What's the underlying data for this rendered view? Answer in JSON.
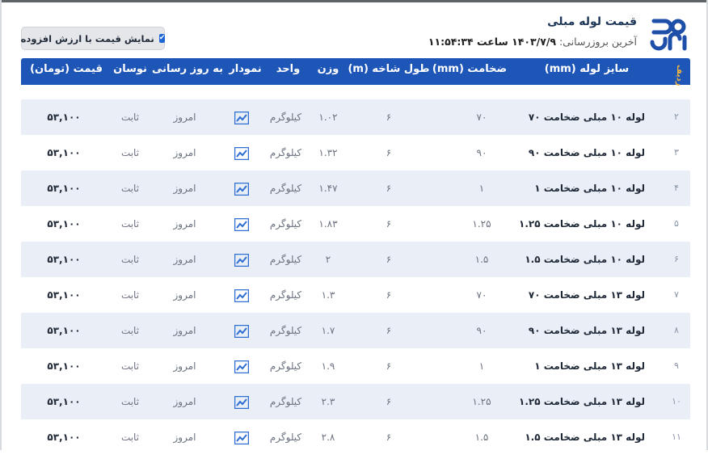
{
  "header": {
    "title": "قیمت لوله مبلی",
    "updated_label": "آخرین بروزرسانی:",
    "updated_value": "۱۴۰۳/۷/۹ ساعت ۱۱:۵۴:۳۴",
    "vat_toggle_label": "نمایش قیمت با ارزش افزوده",
    "vat_checked": true
  },
  "colors": {
    "header_bar": "#1e56b8",
    "alt_row": "#e9eef7",
    "accent": "#1e66d6"
  },
  "table": {
    "columns": {
      "row": "ردیف",
      "size": "سایز لوله (mm)",
      "thickness": "ضخامت (mm)",
      "length": "طول شاخه (m)",
      "weight": "وزن",
      "unit": "واحد",
      "chart": "نمودار",
      "updated": "به روز رسانی",
      "fluctuation": "نوسان",
      "price": "قیمت (تومان)"
    },
    "rows": [
      {
        "num": "۲",
        "size": "لوله ۱۰ مبلی ضخامت ۷۰",
        "thickness": "۷۰",
        "length": "۶",
        "weight": "۱.۰۲",
        "unit": "کیلوگرم",
        "chart_icon": "chart-trend-icon",
        "updated": "امروز",
        "fluctuation": "ثابت",
        "price": "۵۳,۱۰۰"
      },
      {
        "num": "۳",
        "size": "لوله ۱۰ مبلی ضخامت ۹۰",
        "thickness": "۹۰",
        "length": "۶",
        "weight": "۱.۳۲",
        "unit": "کیلوگرم",
        "chart_icon": "chart-trend-icon",
        "updated": "امروز",
        "fluctuation": "ثابت",
        "price": "۵۳,۱۰۰"
      },
      {
        "num": "۴",
        "size": "لوله ۱۰ مبلی ضخامت ۱",
        "thickness": "۱",
        "length": "۶",
        "weight": "۱.۴۷",
        "unit": "کیلوگرم",
        "chart_icon": "chart-trend-icon",
        "updated": "امروز",
        "fluctuation": "ثابت",
        "price": "۵۳,۱۰۰"
      },
      {
        "num": "۵",
        "size": "لوله ۱۰ مبلی ضخامت ۱.۲۵",
        "thickness": "۱.۲۵",
        "length": "۶",
        "weight": "۱.۸۳",
        "unit": "کیلوگرم",
        "chart_icon": "chart-trend-icon",
        "updated": "امروز",
        "fluctuation": "ثابت",
        "price": "۵۳,۱۰۰"
      },
      {
        "num": "۶",
        "size": "لوله ۱۰ مبلی ضخامت ۱.۵",
        "thickness": "۱.۵",
        "length": "۶",
        "weight": "۲",
        "unit": "کیلوگرم",
        "chart_icon": "chart-trend-icon",
        "updated": "امروز",
        "fluctuation": "ثابت",
        "price": "۵۳,۱۰۰"
      },
      {
        "num": "۷",
        "size": "لوله ۱۳ مبلی ضخامت ۷۰",
        "thickness": "۷۰",
        "length": "۶",
        "weight": "۱.۳",
        "unit": "کیلوگرم",
        "chart_icon": "chart-trend-icon",
        "updated": "امروز",
        "fluctuation": "ثابت",
        "price": "۵۳,۱۰۰"
      },
      {
        "num": "۸",
        "size": "لوله ۱۳ مبلی ضخامت ۹۰",
        "thickness": "۹۰",
        "length": "۶",
        "weight": "۱.۷",
        "unit": "کیلوگرم",
        "chart_icon": "chart-trend-icon",
        "updated": "امروز",
        "fluctuation": "ثابت",
        "price": "۵۳,۱۰۰"
      },
      {
        "num": "۹",
        "size": "لوله ۱۳ مبلی ضخامت ۱",
        "thickness": "۱",
        "length": "۶",
        "weight": "۱.۹",
        "unit": "کیلوگرم",
        "chart_icon": "chart-trend-icon",
        "updated": "امروز",
        "fluctuation": "ثابت",
        "price": "۵۳,۱۰۰"
      },
      {
        "num": "۱۰",
        "size": "لوله ۱۳ مبلی ضخامت ۱.۲۵",
        "thickness": "۱.۲۵",
        "length": "۶",
        "weight": "۲.۳",
        "unit": "کیلوگرم",
        "chart_icon": "chart-trend-icon",
        "updated": "امروز",
        "fluctuation": "ثابت",
        "price": "۵۳,۱۰۰"
      },
      {
        "num": "۱۱",
        "size": "لوله ۱۳ مبلی ضخامت ۱.۵",
        "thickness": "۱.۵",
        "length": "۶",
        "weight": "۲.۸",
        "unit": "کیلوگرم",
        "chart_icon": "chart-trend-icon",
        "updated": "امروز",
        "fluctuation": "ثابت",
        "price": "۵۳,۱۰۰"
      }
    ]
  }
}
